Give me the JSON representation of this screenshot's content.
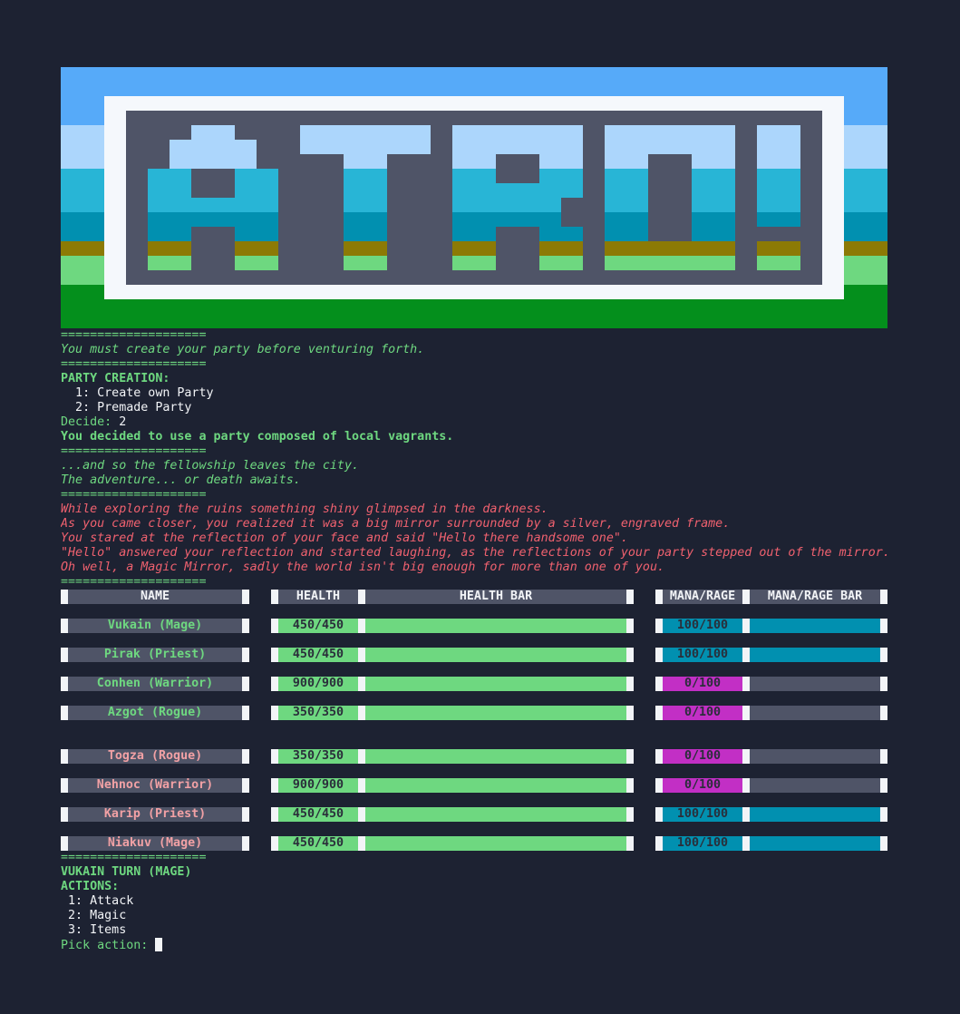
{
  "colors": {
    "background": "#1d2232",
    "green": "#6ed880",
    "red": "#f0616f",
    "ally_name": "#6ed880",
    "enemy_name": "#f2a1a5",
    "cell_bg": "#4f5467",
    "health_fill": "#6ed880",
    "mana_fill": "#0190b0",
    "rage_fill": "#c22fc5",
    "value_text": "#2a2e3a"
  },
  "banner": {
    "title": "ATRO!"
  },
  "separator": "====================",
  "intro_message": "You must create your party before venturing forth.",
  "party_creation": {
    "heading": "PARTY CREATION:",
    "options": [
      "  1: Create own Party",
      "  2: Premade Party"
    ],
    "prompt": "Decide: ",
    "answer": "2",
    "result": "You decided to use a party composed of local vagrants."
  },
  "fellowship": [
    "...and so the fellowship leaves the city.",
    "The adventure... or death awaits."
  ],
  "event_text": [
    "While exploring the ruins something shiny glimpsed in the darkness.",
    "As you came closer, you realized it was a big mirror surrounded by a silver, engraved frame.",
    "You stared at the reflection of your face and said \"Hello there handsome one\".",
    "\"Hello\" answered your reflection and started laughing, as the reflections of your party stepped out of the mirror.",
    "Oh well, a Magic Mirror, sadly the world isn't big enough for more than one of you."
  ],
  "table": {
    "headers": {
      "name": "NAME",
      "health": "HEALTH",
      "health_bar": "HEALTH BAR",
      "mana": "MANA/RAGE",
      "mana_bar": "MANA/RAGE BAR"
    },
    "party": [
      {
        "name": "Vukain (Mage)",
        "health": "450/450",
        "health_pct": 1.0,
        "mana": "100/100",
        "mana_pct": 1.0,
        "resource": "mana"
      },
      {
        "name": "Pirak (Priest)",
        "health": "450/450",
        "health_pct": 1.0,
        "mana": "100/100",
        "mana_pct": 1.0,
        "resource": "mana"
      },
      {
        "name": "Conhen (Warrior)",
        "health": "900/900",
        "health_pct": 1.0,
        "mana": "0/100",
        "mana_pct": 0.0,
        "resource": "rage"
      },
      {
        "name": "Azgot (Rogue)",
        "health": "350/350",
        "health_pct": 1.0,
        "mana": "0/100",
        "mana_pct": 0.0,
        "resource": "rage"
      }
    ],
    "enemies": [
      {
        "name": "Togza (Rogue)",
        "health": "350/350",
        "health_pct": 1.0,
        "mana": "0/100",
        "mana_pct": 0.0,
        "resource": "rage"
      },
      {
        "name": "Nehnoc (Warrior)",
        "health": "900/900",
        "health_pct": 1.0,
        "mana": "0/100",
        "mana_pct": 0.0,
        "resource": "rage"
      },
      {
        "name": "Karip (Priest)",
        "health": "450/450",
        "health_pct": 1.0,
        "mana": "100/100",
        "mana_pct": 1.0,
        "resource": "mana"
      },
      {
        "name": "Niakuv (Mage)",
        "health": "450/450",
        "health_pct": 1.0,
        "mana": "100/100",
        "mana_pct": 1.0,
        "resource": "mana"
      }
    ]
  },
  "turn": {
    "heading": "VUKAIN TURN (MAGE)",
    "actions_label": "ACTIONS:",
    "actions": [
      " 1: Attack",
      " 2: Magic",
      " 3: Items"
    ],
    "prompt": "Pick action: "
  }
}
